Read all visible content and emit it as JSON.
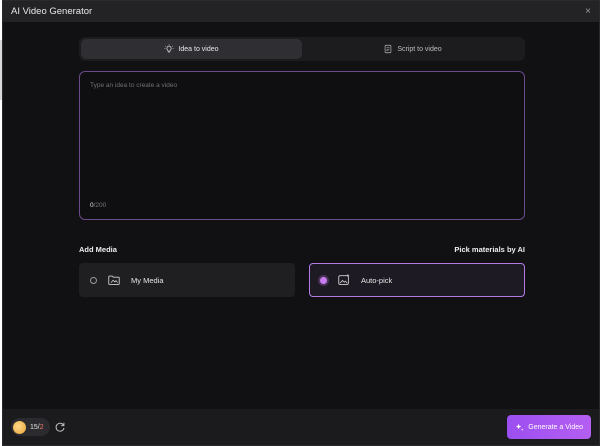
{
  "window": {
    "title": "AI Video Generator",
    "close_symbol": "×"
  },
  "tabs": [
    {
      "label": "Idea to video",
      "active": true,
      "icon": "lightbulb-icon"
    },
    {
      "label": "Script to video",
      "active": false,
      "icon": "document-icon"
    }
  ],
  "prompt": {
    "placeholder": "Type an idea to create a video",
    "value": "",
    "count_current": "0",
    "count_max": "/200"
  },
  "media": {
    "heading": "Add Media",
    "right_heading": "Pick materials by AI",
    "options": [
      {
        "label": "My Media",
        "selected": false,
        "icon": "folder-media-icon"
      },
      {
        "label": "Auto-pick",
        "selected": true,
        "icon": "ai-image-icon"
      }
    ]
  },
  "footer": {
    "credits_main": "15/",
    "credits_highlight": "2",
    "generate_label": "Generate a Video"
  },
  "colors": {
    "accent": "#b45ff2",
    "selected_border": "#b57ae6",
    "background": "#111113"
  }
}
